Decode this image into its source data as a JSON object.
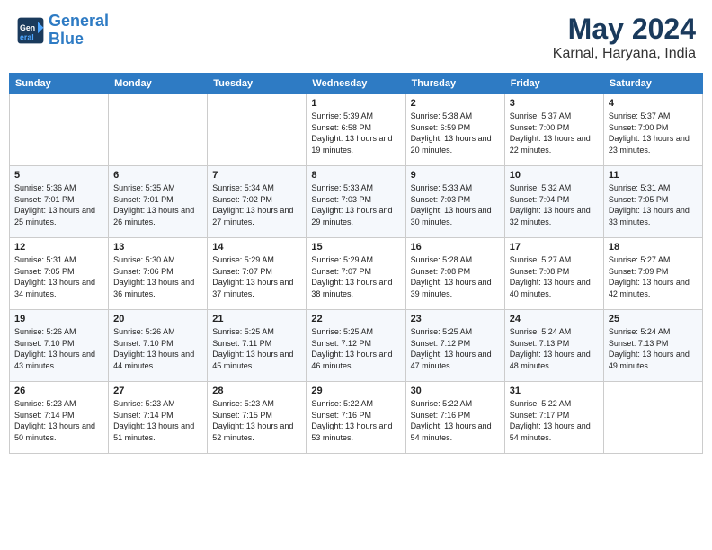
{
  "header": {
    "logo_line1": "General",
    "logo_line2": "Blue",
    "month": "May 2024",
    "location": "Karnal, Haryana, India"
  },
  "weekdays": [
    "Sunday",
    "Monday",
    "Tuesday",
    "Wednesday",
    "Thursday",
    "Friday",
    "Saturday"
  ],
  "weeks": [
    [
      {
        "day": "",
        "info": ""
      },
      {
        "day": "",
        "info": ""
      },
      {
        "day": "",
        "info": ""
      },
      {
        "day": "1",
        "info": "Sunrise: 5:39 AM\nSunset: 6:58 PM\nDaylight: 13 hours\nand 19 minutes."
      },
      {
        "day": "2",
        "info": "Sunrise: 5:38 AM\nSunset: 6:59 PM\nDaylight: 13 hours\nand 20 minutes."
      },
      {
        "day": "3",
        "info": "Sunrise: 5:37 AM\nSunset: 7:00 PM\nDaylight: 13 hours\nand 22 minutes."
      },
      {
        "day": "4",
        "info": "Sunrise: 5:37 AM\nSunset: 7:00 PM\nDaylight: 13 hours\nand 23 minutes."
      }
    ],
    [
      {
        "day": "5",
        "info": "Sunrise: 5:36 AM\nSunset: 7:01 PM\nDaylight: 13 hours\nand 25 minutes."
      },
      {
        "day": "6",
        "info": "Sunrise: 5:35 AM\nSunset: 7:01 PM\nDaylight: 13 hours\nand 26 minutes."
      },
      {
        "day": "7",
        "info": "Sunrise: 5:34 AM\nSunset: 7:02 PM\nDaylight: 13 hours\nand 27 minutes."
      },
      {
        "day": "8",
        "info": "Sunrise: 5:33 AM\nSunset: 7:03 PM\nDaylight: 13 hours\nand 29 minutes."
      },
      {
        "day": "9",
        "info": "Sunrise: 5:33 AM\nSunset: 7:03 PM\nDaylight: 13 hours\nand 30 minutes."
      },
      {
        "day": "10",
        "info": "Sunrise: 5:32 AM\nSunset: 7:04 PM\nDaylight: 13 hours\nand 32 minutes."
      },
      {
        "day": "11",
        "info": "Sunrise: 5:31 AM\nSunset: 7:05 PM\nDaylight: 13 hours\nand 33 minutes."
      }
    ],
    [
      {
        "day": "12",
        "info": "Sunrise: 5:31 AM\nSunset: 7:05 PM\nDaylight: 13 hours\nand 34 minutes."
      },
      {
        "day": "13",
        "info": "Sunrise: 5:30 AM\nSunset: 7:06 PM\nDaylight: 13 hours\nand 36 minutes."
      },
      {
        "day": "14",
        "info": "Sunrise: 5:29 AM\nSunset: 7:07 PM\nDaylight: 13 hours\nand 37 minutes."
      },
      {
        "day": "15",
        "info": "Sunrise: 5:29 AM\nSunset: 7:07 PM\nDaylight: 13 hours\nand 38 minutes."
      },
      {
        "day": "16",
        "info": "Sunrise: 5:28 AM\nSunset: 7:08 PM\nDaylight: 13 hours\nand 39 minutes."
      },
      {
        "day": "17",
        "info": "Sunrise: 5:27 AM\nSunset: 7:08 PM\nDaylight: 13 hours\nand 40 minutes."
      },
      {
        "day": "18",
        "info": "Sunrise: 5:27 AM\nSunset: 7:09 PM\nDaylight: 13 hours\nand 42 minutes."
      }
    ],
    [
      {
        "day": "19",
        "info": "Sunrise: 5:26 AM\nSunset: 7:10 PM\nDaylight: 13 hours\nand 43 minutes."
      },
      {
        "day": "20",
        "info": "Sunrise: 5:26 AM\nSunset: 7:10 PM\nDaylight: 13 hours\nand 44 minutes."
      },
      {
        "day": "21",
        "info": "Sunrise: 5:25 AM\nSunset: 7:11 PM\nDaylight: 13 hours\nand 45 minutes."
      },
      {
        "day": "22",
        "info": "Sunrise: 5:25 AM\nSunset: 7:12 PM\nDaylight: 13 hours\nand 46 minutes."
      },
      {
        "day": "23",
        "info": "Sunrise: 5:25 AM\nSunset: 7:12 PM\nDaylight: 13 hours\nand 47 minutes."
      },
      {
        "day": "24",
        "info": "Sunrise: 5:24 AM\nSunset: 7:13 PM\nDaylight: 13 hours\nand 48 minutes."
      },
      {
        "day": "25",
        "info": "Sunrise: 5:24 AM\nSunset: 7:13 PM\nDaylight: 13 hours\nand 49 minutes."
      }
    ],
    [
      {
        "day": "26",
        "info": "Sunrise: 5:23 AM\nSunset: 7:14 PM\nDaylight: 13 hours\nand 50 minutes."
      },
      {
        "day": "27",
        "info": "Sunrise: 5:23 AM\nSunset: 7:14 PM\nDaylight: 13 hours\nand 51 minutes."
      },
      {
        "day": "28",
        "info": "Sunrise: 5:23 AM\nSunset: 7:15 PM\nDaylight: 13 hours\nand 52 minutes."
      },
      {
        "day": "29",
        "info": "Sunrise: 5:22 AM\nSunset: 7:16 PM\nDaylight: 13 hours\nand 53 minutes."
      },
      {
        "day": "30",
        "info": "Sunrise: 5:22 AM\nSunset: 7:16 PM\nDaylight: 13 hours\nand 54 minutes."
      },
      {
        "day": "31",
        "info": "Sunrise: 5:22 AM\nSunset: 7:17 PM\nDaylight: 13 hours\nand 54 minutes."
      },
      {
        "day": "",
        "info": ""
      }
    ]
  ]
}
